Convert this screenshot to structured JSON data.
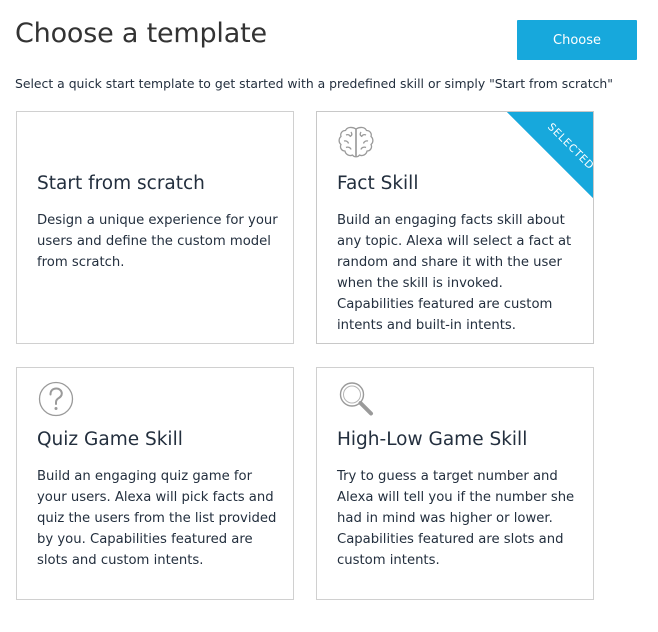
{
  "header": {
    "title": "Choose a template",
    "choose_label": "Choose"
  },
  "subtitle": "Select a quick start template to get started with a predefined skill or simply \"Start from scratch\"",
  "templates": [
    {
      "icon": "",
      "title": "Start from scratch",
      "description": "Design a unique experience for your users and define the custom model from scratch.",
      "selected": false
    },
    {
      "icon": "brain-icon",
      "title": "Fact Skill",
      "description": "Build an engaging facts skill about any topic. Alexa will select a fact at random and share it with the user when the skill is invoked. Capabilities featured are custom intents and built-in intents.",
      "selected": true,
      "badge": "SELECTED"
    },
    {
      "icon": "question-mark-icon",
      "title": "Quiz Game Skill",
      "description": "Build an engaging quiz game for your users. Alexa will pick facts and quiz the users from the list provided by you. Capabilities featured are slots and custom intents.",
      "selected": false
    },
    {
      "icon": "magnifier-icon",
      "title": "High-Low Game Skill",
      "description": "Try to guess a target number and Alexa will tell you if the number she had in mind was higher or lower. Capabilities featured are slots and custom intents.",
      "selected": false
    }
  ],
  "colors": {
    "accent": "#17a8dc",
    "text": "#232f3e",
    "border": "#d0d0d0",
    "icon": "#9a9a9a"
  }
}
